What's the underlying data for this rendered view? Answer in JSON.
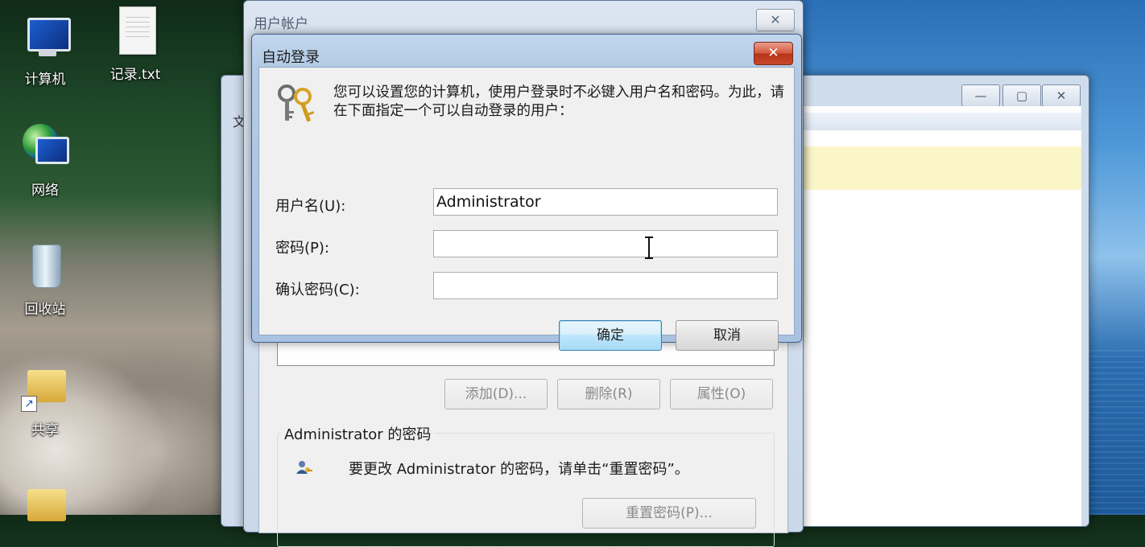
{
  "desktop": {
    "icons": [
      {
        "label": "计算机",
        "icon": "computer-icon"
      },
      {
        "label": "记录.txt",
        "icon": "text-file-icon"
      },
      {
        "label": "网络",
        "icon": "network-icon"
      },
      {
        "label": "回收站",
        "icon": "recycle-bin-icon"
      },
      {
        "label": "共享",
        "icon": "shared-folder-shortcut-icon"
      }
    ]
  },
  "explorer_window": {
    "minimize": "—",
    "maximize": "▢",
    "close": "✕",
    "partial_menu_char": "文"
  },
  "user_accounts_window": {
    "title": "用户帐户",
    "close": "✕",
    "buttons": {
      "add": "添加(D)...",
      "remove": "删除(R)",
      "properties": "属性(O)"
    },
    "password_group": {
      "title": "Administrator 的密码",
      "text": "要更改 Administrator 的密码，请单击“重置密码”。",
      "reset_button": "重置密码(P)..."
    }
  },
  "autologon_dialog": {
    "title": "自动登录",
    "close": "✕",
    "intro": "您可以设置您的计算机，使用户登录时不必键入用户名和密码。为此，请在下面指定一个可以自动登录的用户：",
    "fields": {
      "username_label": "用户名(U):",
      "username_value": "Administrator",
      "password_label": "密码(P):",
      "password_value": "",
      "confirm_label": "确认密码(C):",
      "confirm_value": ""
    },
    "ok": "确定",
    "cancel": "取消"
  }
}
